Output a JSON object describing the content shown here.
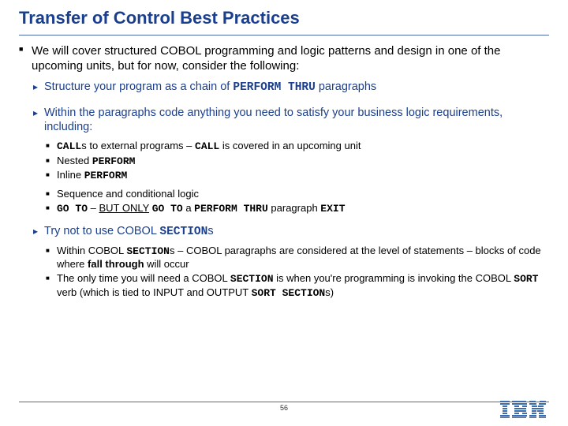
{
  "title": "Transfer of Control Best Practices",
  "intro": "We will cover structured COBOL programming and logic patterns and design in one of the upcoming units, but for now, consider the following:",
  "p1_a": "Structure your program as a chain of ",
  "p1_b": " paragraphs",
  "p2": "Within the paragraphs code anything you need to satisfy your business logic requirements, including:",
  "p2_i1_a": "s to external programs – ",
  "p2_i1_b": " is covered in an upcoming unit",
  "p2_i2": "Nested ",
  "p2_i3": "Inline ",
  "p2_i4": "Sequence and conditional logic",
  "p2_i5_a": " – ",
  "p2_i5_b": "BUT ONLY",
  "p2_i5_c": " a ",
  "p2_i5_d": " paragraph ",
  "p3_a": "Try not to use COBOL ",
  "p3_b": "s",
  "p3_i1_a": "Within COBOL ",
  "p3_i1_b": "s – COBOL paragraphs are considered at the level of statements – blocks of code where ",
  "p3_i1_c": "fall through",
  "p3_i1_d": " will occur",
  "p3_i2_a": "The only time you will need a COBOL ",
  "p3_i2_b": " is when you're programming is invoking the COBOL ",
  "p3_i2_c": " verb (which is tied to INPUT and OUTPUT ",
  "p3_i2_d": "s)",
  "kw": {
    "perform_thru": "PERFORM THRU",
    "call": "CALL",
    "perform": "PERFORM",
    "go_to": "GO TO",
    "exit": "EXIT",
    "section": "SECTION",
    "sort": "SORT",
    "sort_section": "SORT SECTION"
  },
  "page": "56",
  "logo_alt": "IBM"
}
